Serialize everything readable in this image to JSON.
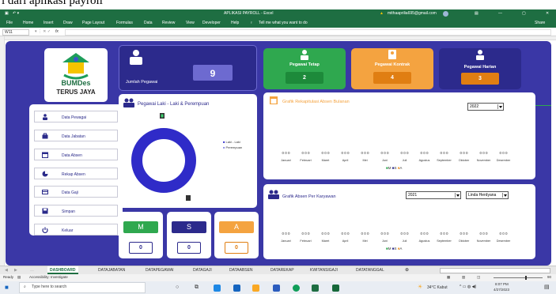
{
  "page": {
    "heading_fragment": "i dari aplikasi payroll"
  },
  "excel": {
    "title": "APLIKASI PAYROLL - Excel",
    "account": "mithaaprilia695@gmail.com",
    "share": "Share",
    "tell_me": "Tell me what you want to do",
    "cell_ref": "W11",
    "fx": "fx",
    "menus": [
      "File",
      "Home",
      "Insert",
      "Draw",
      "Page Layout",
      "Formulas",
      "Data",
      "Review",
      "View",
      "Developer",
      "Help"
    ]
  },
  "logo": {
    "brand": "BUMDes",
    "name": "TERUS JAYA"
  },
  "colors": {
    "panel": "#3a37a6",
    "accent": "#1e6e42"
  },
  "sidebar": {
    "items": [
      {
        "label": "Data Pewagai",
        "icon": "user-icon"
      },
      {
        "label": "Data Jabatan",
        "icon": "briefcase-icon"
      },
      {
        "label": "Data Absen",
        "icon": "calendar-icon"
      },
      {
        "label": "Rekap Absen",
        "icon": "report-icon"
      },
      {
        "label": "Data Gaji",
        "icon": "money-icon"
      },
      {
        "label": "Simpan",
        "icon": "save-icon"
      },
      {
        "label": "Keluar",
        "icon": "power-icon"
      }
    ]
  },
  "stats": {
    "total": {
      "label": "Jumlah Pegawai",
      "value": "9"
    },
    "tetap": {
      "label": "Pegawai Tetap",
      "value": "2"
    },
    "kontrak": {
      "label": "Pegawai Kontrak",
      "value": "4"
    },
    "harian": {
      "label": "Pegawai Harian",
      "value": "3"
    }
  },
  "gender": {
    "title": "Pegawai Laki - Laki & Perempuan",
    "legend": [
      "Laki - Laki",
      "Perempuan"
    ]
  },
  "attendance": {
    "codes": [
      "M",
      "S",
      "A"
    ],
    "values": [
      "0",
      "0",
      "0"
    ]
  },
  "chart_bulanan": {
    "title": "Grafik Rekapitulasi Absen Bulanan",
    "filter": "2022",
    "months": [
      "Januari",
      "Februari",
      "Maret",
      "April",
      "Mei",
      "Juni",
      "Juli",
      "Agustus",
      "September",
      "Oktober",
      "November",
      "Desember"
    ],
    "labels": [
      "0 0 0",
      "0 0 0",
      "0 0 0",
      "0 0 0",
      "0 0 0",
      "0 0 0",
      "0 0 0",
      "0 0 0",
      "0 0 0",
      "0 0 0",
      "0 0 0",
      "0 0 0"
    ],
    "legend": [
      "M",
      "S",
      "A"
    ]
  },
  "chart_karyawan": {
    "title": "Grafik Absen Per Karyawan",
    "filter_year": "2021",
    "filter_name": "Linda Herdyana",
    "months": [
      "Januari",
      "Februari",
      "Maret",
      "April",
      "Mei",
      "Juni",
      "Juli",
      "Agustus",
      "September",
      "Oktober",
      "November",
      "Desember"
    ],
    "labels": [
      "0 0 0",
      "0 0 0",
      "0 0 0",
      "0 0 0",
      "0 0 0",
      "0 0 0",
      "0 0 0",
      "0 0 0",
      "0 0 0",
      "0 0 0",
      "0 0 0",
      "0 0 0"
    ],
    "legend": [
      "M",
      "S",
      "A"
    ]
  },
  "sheets": [
    "DASHBOARD",
    "DATAJABATAN",
    "DATAPEGAWAI",
    "DATAGAJI",
    "DATAABSEN",
    "DATAREKAP",
    "KWITANSIGAJI",
    "DATATANGGAL"
  ],
  "status": {
    "ready": "Ready",
    "accessibility": "Accessibility: Investigate",
    "zoom": "90"
  },
  "taskbar": {
    "search": "Type here to search",
    "weather": "34°C Kabut",
    "time": "8:07 PM",
    "date": "4/27/2023"
  },
  "chart_data": [
    {
      "type": "bar",
      "title": "Grafik Rekapitulasi Absen Bulanan",
      "categories": [
        "Januari",
        "Februari",
        "Maret",
        "April",
        "Mei",
        "Juni",
        "Juli",
        "Agustus",
        "September",
        "Oktober",
        "November",
        "Desember"
      ],
      "series": [
        {
          "name": "M",
          "values": [
            0,
            0,
            0,
            0,
            0,
            0,
            0,
            0,
            0,
            0,
            0,
            0
          ]
        },
        {
          "name": "S",
          "values": [
            0,
            0,
            0,
            0,
            0,
            0,
            0,
            0,
            0,
            0,
            0,
            0
          ]
        },
        {
          "name": "A",
          "values": [
            0,
            0,
            0,
            0,
            0,
            0,
            0,
            0,
            0,
            0,
            0,
            0
          ]
        }
      ]
    },
    {
      "type": "bar",
      "title": "Grafik Absen Per Karyawan",
      "categories": [
        "Januari",
        "Februari",
        "Maret",
        "April",
        "Mei",
        "Juni",
        "Juli",
        "Agustus",
        "September",
        "Oktober",
        "November",
        "Desember"
      ],
      "series": [
        {
          "name": "M",
          "values": [
            0,
            0,
            0,
            0,
            0,
            0,
            0,
            0,
            0,
            0,
            0,
            0
          ]
        },
        {
          "name": "S",
          "values": [
            0,
            0,
            0,
            0,
            0,
            0,
            0,
            0,
            0,
            0,
            0,
            0
          ]
        },
        {
          "name": "A",
          "values": [
            0,
            0,
            0,
            0,
            0,
            0,
            0,
            0,
            0,
            0,
            0,
            0
          ]
        }
      ]
    }
  ]
}
